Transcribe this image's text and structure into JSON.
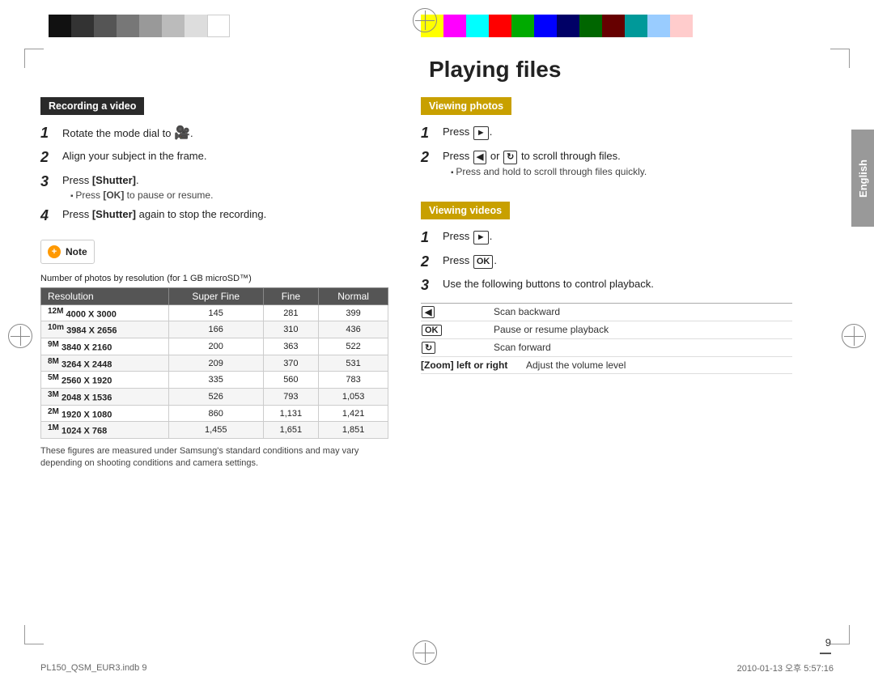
{
  "page": {
    "title": "Playing files",
    "number": "9",
    "bottom_left": "PL150_QSM_EUR3.indb   9",
    "bottom_right": "2010-01-13   오후 5:57:16",
    "english_label": "English"
  },
  "left_column": {
    "section_title": "Recording a video",
    "steps": [
      {
        "num": "1",
        "text": "Rotate the mode dial to"
      },
      {
        "num": "2",
        "text": "Align your subject in the frame."
      },
      {
        "num": "3",
        "text": "Press [Shutter].",
        "sub": "Press [OK] to pause or resume."
      },
      {
        "num": "4",
        "text": "Press [Shutter] again to stop the recording."
      }
    ],
    "note_label": "Note",
    "table_title": "Number of photos by resolution",
    "table_subtitle": "(for 1 GB microSD™)",
    "table_headers": [
      "Resolution",
      "Super Fine",
      "Fine",
      "Normal"
    ],
    "table_rows": [
      {
        "icon": "12M",
        "res": "4000 X 3000",
        "sf": "145",
        "f": "281",
        "n": "399"
      },
      {
        "icon": "10m",
        "res": "3984 X 2656",
        "sf": "166",
        "f": "310",
        "n": "436"
      },
      {
        "icon": "9M",
        "res": "3840 X 2160",
        "sf": "200",
        "f": "363",
        "n": "522"
      },
      {
        "icon": "8M",
        "res": "3264 X 2448",
        "sf": "209",
        "f": "370",
        "n": "531"
      },
      {
        "icon": "5M",
        "res": "2560 X 1920",
        "sf": "335",
        "f": "560",
        "n": "783"
      },
      {
        "icon": "3M",
        "res": "2048 X 1536",
        "sf": "526",
        "f": "793",
        "n": "1,053"
      },
      {
        "icon": "2M",
        "res": "1920 X 1080",
        "sf": "860",
        "f": "1,131",
        "n": "1,421"
      },
      {
        "icon": "1M",
        "res": "1024 X 768",
        "sf": "1,455",
        "f": "1,651",
        "n": "1,851"
      }
    ],
    "footnote": "These figures are measured under Samsung's standard conditions and may vary depending on shooting conditions and camera settings."
  },
  "right_column": {
    "viewing_photos": {
      "section_title": "Viewing photos",
      "steps": [
        {
          "num": "1",
          "text": "Press [▶]."
        },
        {
          "num": "2",
          "text": "Press [◀] or [↻] to scroll through files.",
          "sub": "Press and hold to scroll through files quickly."
        }
      ]
    },
    "viewing_videos": {
      "section_title": "Viewing videos",
      "steps": [
        {
          "num": "1",
          "text": "Press [▶]."
        },
        {
          "num": "2",
          "text": "Press [OK]."
        },
        {
          "num": "3",
          "text": "Use the following buttons to control playback."
        }
      ],
      "controls": [
        {
          "key": "[◀]",
          "desc": "Scan backward"
        },
        {
          "key": "[OK]",
          "desc": "Pause or resume playback"
        },
        {
          "key": "[↻]",
          "desc": "Scan forward"
        },
        {
          "key": "[Zoom] left or right",
          "desc": "Adjust the volume level"
        }
      ]
    }
  }
}
